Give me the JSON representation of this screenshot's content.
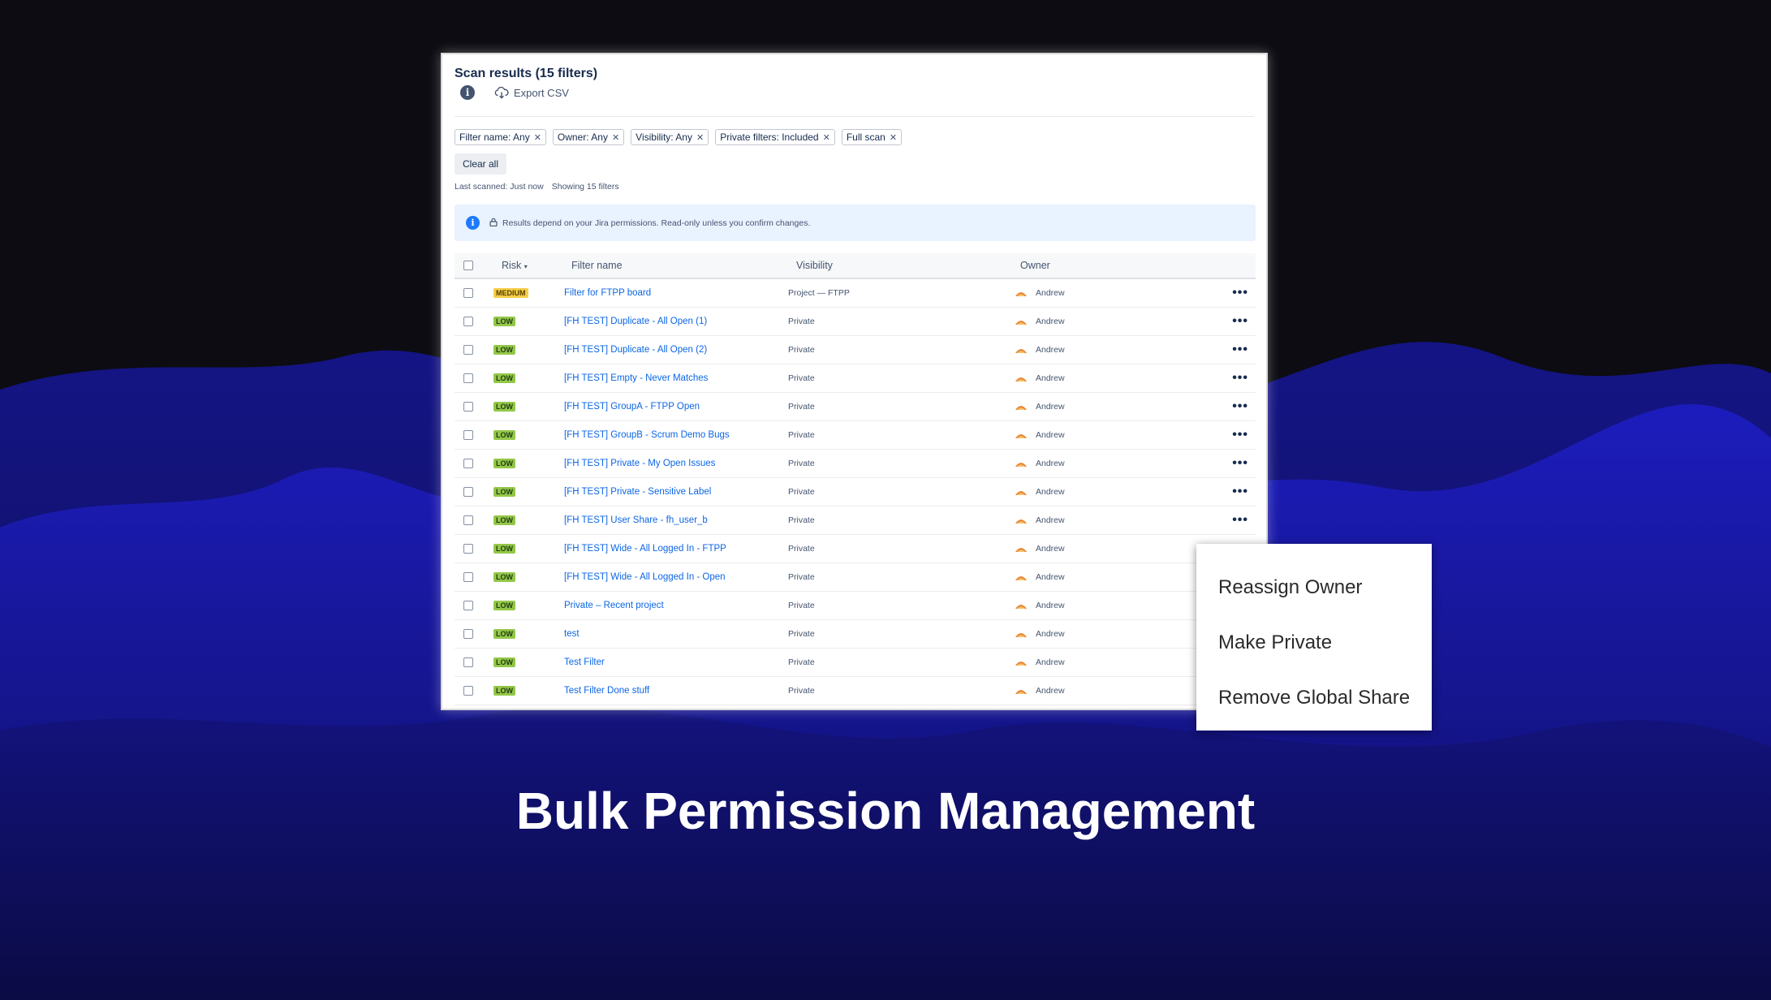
{
  "colors": {
    "background_top": "#0c0c12",
    "wave_blue": "#1a1ab8",
    "link": "#0c66e4",
    "risk_low": "#94c748",
    "risk_medium": "#f5cd47"
  },
  "panel": {
    "title": "Scan results (15 filters)",
    "export_label": "Export CSV",
    "chips": [
      {
        "label": "Filter name: Any"
      },
      {
        "label": "Owner: Any"
      },
      {
        "label": "Visibility: Any"
      },
      {
        "label": "Private filters: Included"
      },
      {
        "label": "Full scan"
      }
    ],
    "clear_all": "Clear all",
    "last_scanned": "Last scanned: Just now",
    "showing": "Showing 15 filters",
    "banner_text": "Results depend on your Jira permissions. Read-only unless you confirm changes.",
    "columns": {
      "risk": "Risk",
      "filter_name": "Filter name",
      "visibility": "Visibility",
      "owner": "Owner"
    },
    "rows": [
      {
        "risk": "MEDIUM",
        "name": "Filter for FTPP board",
        "visibility": "Project — FTPP",
        "owner": "Andrew",
        "has_menu": true
      },
      {
        "risk": "LOW",
        "name": "[FH TEST] Duplicate - All Open (1)",
        "visibility": "Private",
        "owner": "Andrew",
        "has_menu": true
      },
      {
        "risk": "LOW",
        "name": "[FH TEST] Duplicate - All Open (2)",
        "visibility": "Private",
        "owner": "Andrew",
        "has_menu": true
      },
      {
        "risk": "LOW",
        "name": "[FH TEST] Empty - Never Matches",
        "visibility": "Private",
        "owner": "Andrew",
        "has_menu": true
      },
      {
        "risk": "LOW",
        "name": "[FH TEST] GroupA - FTPP Open",
        "visibility": "Private",
        "owner": "Andrew",
        "has_menu": true
      },
      {
        "risk": "LOW",
        "name": "[FH TEST] GroupB - Scrum Demo Bugs",
        "visibility": "Private",
        "owner": "Andrew",
        "has_menu": true
      },
      {
        "risk": "LOW",
        "name": "[FH TEST] Private - My Open Issues",
        "visibility": "Private",
        "owner": "Andrew",
        "has_menu": true
      },
      {
        "risk": "LOW",
        "name": "[FH TEST] Private - Sensitive Label",
        "visibility": "Private",
        "owner": "Andrew",
        "has_menu": true
      },
      {
        "risk": "LOW",
        "name": "[FH TEST] User Share - fh_user_b",
        "visibility": "Private",
        "owner": "Andrew",
        "has_menu": true
      },
      {
        "risk": "LOW",
        "name": "[FH TEST] Wide - All Logged In - FTPP",
        "visibility": "Private",
        "owner": "Andrew",
        "has_menu": false
      },
      {
        "risk": "LOW",
        "name": "[FH TEST] Wide - All Logged In - Open",
        "visibility": "Private",
        "owner": "Andrew",
        "has_menu": false
      },
      {
        "risk": "LOW",
        "name": "Private – Recent project",
        "visibility": "Private",
        "owner": "Andrew",
        "has_menu": false
      },
      {
        "risk": "LOW",
        "name": "test",
        "visibility": "Private",
        "owner": "Andrew",
        "has_menu": false
      },
      {
        "risk": "LOW",
        "name": "Test Filter",
        "visibility": "Private",
        "owner": "Andrew",
        "has_menu": false
      },
      {
        "risk": "LOW",
        "name": "Test Filter Done stuff",
        "visibility": "Private",
        "owner": "Andrew",
        "has_menu": false
      }
    ]
  },
  "context_menu": {
    "items": [
      {
        "label": "Reassign Owner"
      },
      {
        "label": "Make Private"
      },
      {
        "label": "Remove Global Share"
      }
    ]
  },
  "headline": "Bulk Permission Management"
}
